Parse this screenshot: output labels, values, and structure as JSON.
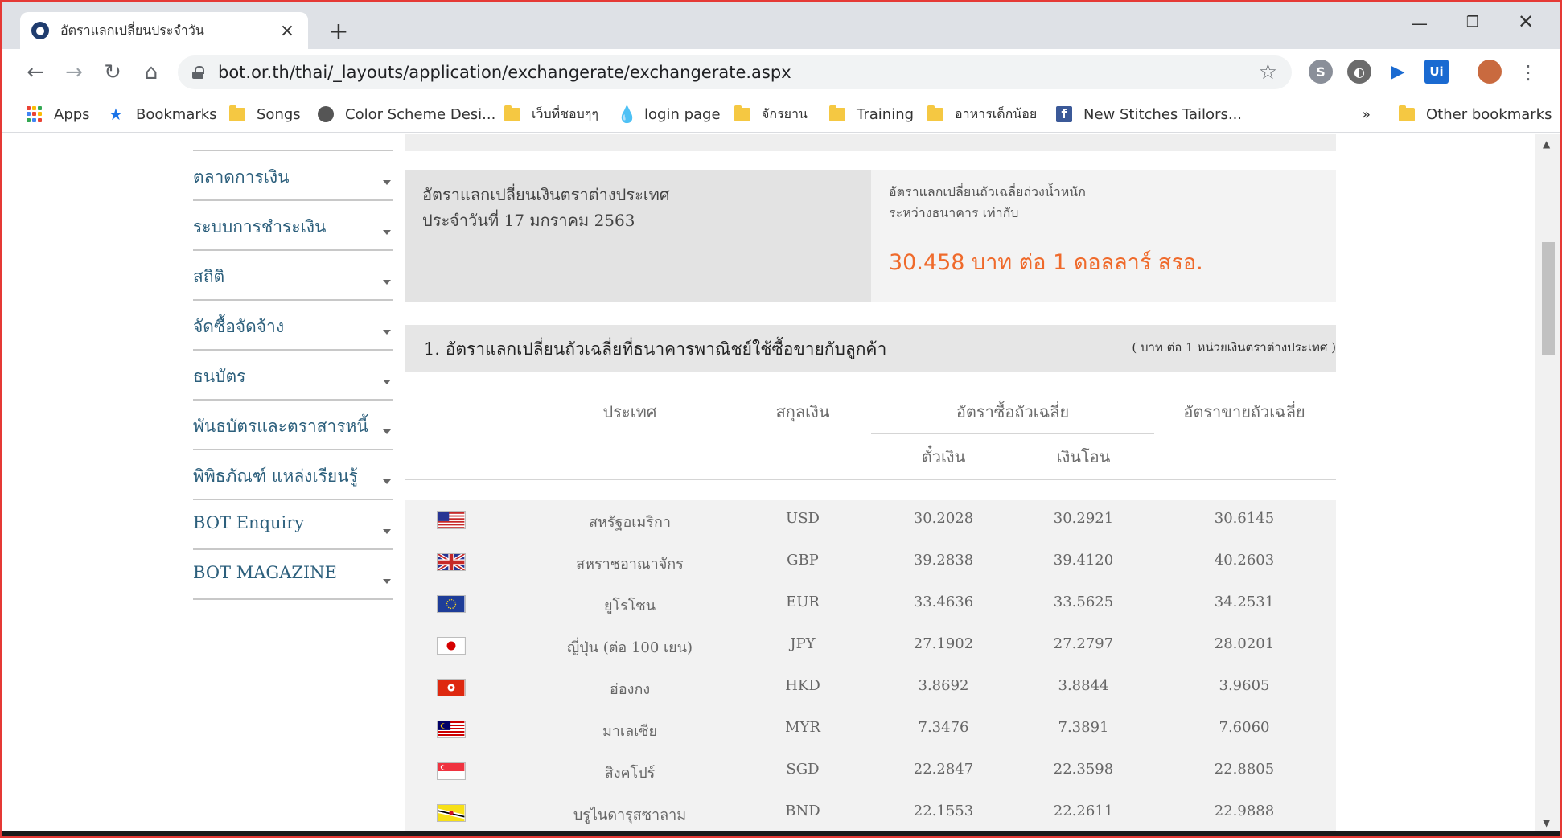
{
  "browser": {
    "tab_title": "อัตราแลกเปลี่ยนประจำวัน",
    "url": "bot.or.th/thai/_layouts/application/exchangerate/exchangerate.aspx",
    "bookmarks": [
      {
        "label": "Apps",
        "icon": "apps-icon"
      },
      {
        "label": "Bookmarks",
        "icon": "star-icon"
      },
      {
        "label": "Songs",
        "icon": "folder-icon"
      },
      {
        "label": "Color Scheme Desi...",
        "icon": "site-icon"
      },
      {
        "label": "เว็บที่ชอบๆๆ",
        "icon": "folder-icon"
      },
      {
        "label": "login page",
        "icon": "drop-icon"
      },
      {
        "label": "จักรยาน",
        "icon": "folder-icon"
      },
      {
        "label": "Training",
        "icon": "folder-icon"
      },
      {
        "label": "อาหารเด็กน้อย",
        "icon": "folder-icon"
      },
      {
        "label": "New Stitches Tailors...",
        "icon": "facebook-icon"
      }
    ],
    "bookmarks_overflow": "»",
    "other_bookmarks": "Other bookmarks"
  },
  "sidebar": {
    "items": [
      {
        "label": "ตลาดการเงิน"
      },
      {
        "label": "ระบบการชำระเงิน"
      },
      {
        "label": "สถิติ"
      },
      {
        "label": "จัดซื้อจัดจ้าง"
      },
      {
        "label": "ธนบัตร"
      },
      {
        "label": "พันธบัตรและตราสารหนี้"
      },
      {
        "label": "พิพิธภัณฑ์ แหล่งเรียนรู้"
      },
      {
        "label": "BOT Enquiry"
      },
      {
        "label": "BOT MAGAZINE"
      }
    ]
  },
  "info": {
    "left_line1": "อัตราแลกเปลี่ยนเงินตราต่างประเทศ",
    "left_line2": "ประจำวันที่ 17 มกราคม 2563",
    "right_line1": "อัตราแลกเปลี่ยนถัวเฉลี่ยถ่วงน้ำหนัก",
    "right_line2": "ระหว่างธนาคาร เท่ากับ",
    "rate_text": "30.458 บาท ต่อ 1 ดอลลาร์ สรอ."
  },
  "section": {
    "title": "1. อัตราแลกเปลี่ยนถัวเฉลี่ยที่ธนาคารพาณิชย์ใช้ซื้อขายกับลูกค้า",
    "unit": "( บาท ต่อ 1 หน่วยเงินตราต่างประเทศ )"
  },
  "table": {
    "headers": {
      "country": "ประเทศ",
      "currency": "สกุลเงิน",
      "buying": "อัตราซื้อถัวเฉลี่ย",
      "selling": "อัตราขายถัวเฉลี่ย",
      "cheque": "ตั๋วเงิน",
      "transfer": "เงินโอน"
    },
    "rows": [
      {
        "flag": "us-flag-icon",
        "country": "สหรัฐอเมริกา",
        "currency": "USD",
        "cheque": "30.2028",
        "transfer": "30.2921",
        "selling": "30.6145"
      },
      {
        "flag": "uk-flag-icon",
        "country": "สหราชอาณาจักร",
        "currency": "GBP",
        "cheque": "39.2838",
        "transfer": "39.4120",
        "selling": "40.2603"
      },
      {
        "flag": "eu-flag-icon",
        "country": "ยูโรโซน",
        "currency": "EUR",
        "cheque": "33.4636",
        "transfer": "33.5625",
        "selling": "34.2531"
      },
      {
        "flag": "jp-flag-icon",
        "country": "ญี่ปุ่น (ต่อ 100 เยน)",
        "currency": "JPY",
        "cheque": "27.1902",
        "transfer": "27.2797",
        "selling": "28.0201"
      },
      {
        "flag": "hk-flag-icon",
        "country": "ฮ่องกง",
        "currency": "HKD",
        "cheque": "3.8692",
        "transfer": "3.8844",
        "selling": "3.9605"
      },
      {
        "flag": "my-flag-icon",
        "country": "มาเลเซีย",
        "currency": "MYR",
        "cheque": "7.3476",
        "transfer": "7.3891",
        "selling": "7.6060"
      },
      {
        "flag": "sg-flag-icon",
        "country": "สิงคโปร์",
        "currency": "SGD",
        "cheque": "22.2847",
        "transfer": "22.3598",
        "selling": "22.8805"
      },
      {
        "flag": "bn-flag-icon",
        "country": "บรูไนดารุสซาลาม",
        "currency": "BND",
        "cheque": "22.1553",
        "transfer": "22.2611",
        "selling": "22.9888"
      }
    ]
  },
  "colors": {
    "sidebar_text": "#2c5f7c",
    "rate_accent": "#ef6a2b",
    "frame": "#e53935"
  }
}
